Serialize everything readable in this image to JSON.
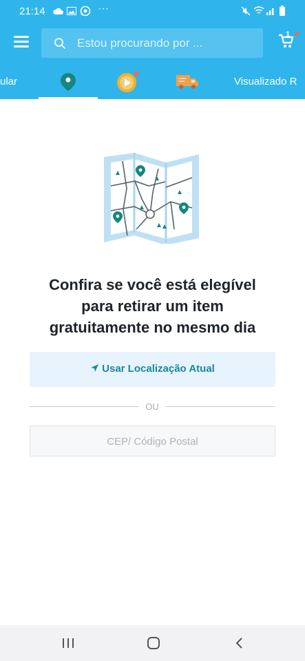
{
  "status_bar": {
    "time": "21:14",
    "more": "···"
  },
  "header": {
    "search_placeholder": "Estou procurando por ...",
    "cart_count": "1"
  },
  "tabs": [
    {
      "label": "ular"
    },
    {
      "icon": "map-pin-icon"
    },
    {
      "icon": "play-coin-icon"
    },
    {
      "icon": "delivery-truck-icon"
    },
    {
      "label": "Visualizado R"
    }
  ],
  "main": {
    "headline_line1": "Confira se você está elegível",
    "headline_line2": "para retirar um item",
    "headline_line3": "gratuitamente no mesmo dia",
    "location_button": "Usar Localização Atual",
    "or_label": "OU",
    "zip_placeholder": "CEP/ Código Postal"
  },
  "colors": {
    "primary": "#2fb5ec",
    "accent": "#1787a0",
    "text": "#1e2328"
  }
}
